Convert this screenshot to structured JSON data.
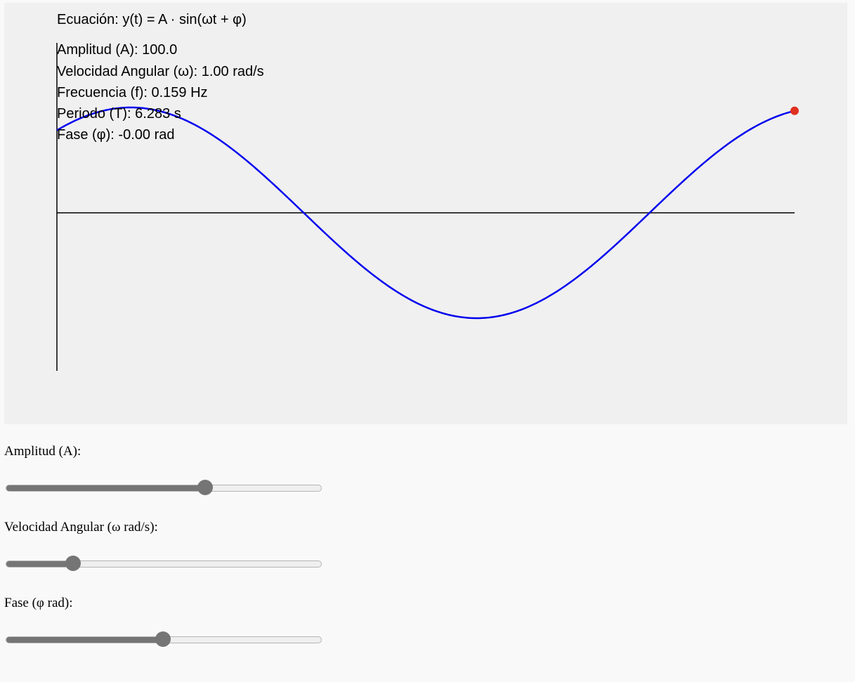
{
  "equation": "Ecuación: y(t) = A · sin(ωt + φ)",
  "stats": {
    "amplitude": "Amplitud (A): 100.0",
    "angular_velocity": "Velocidad Angular (ω): 1.00 rad/s",
    "frequency": "Frecuencia (f): 0.159 Hz",
    "period": "Periodo (T): 6.283 s",
    "phase": "Fase (φ): -0.00 rad"
  },
  "controls": {
    "amplitude": {
      "label": "Amplitud (A):",
      "fraction": 0.64
    },
    "angular_velocity": {
      "label": "Velocidad Angular (ω rad/s):",
      "fraction": 0.2
    },
    "phase": {
      "label": "Fase (φ rad):",
      "fraction": 0.5
    }
  },
  "colors": {
    "wave": "#0000ee",
    "point": "#e03020",
    "axes": "#000000",
    "canvas_bg": "#f0f0f0",
    "slider_fill": "#757575"
  },
  "chart_data": {
    "type": "line",
    "amplitude": 100.0,
    "omega": 1.0,
    "phase": 0.0,
    "t_visible_start": 0.9,
    "t_visible_end": 7.6,
    "point_t": 7.6
  }
}
